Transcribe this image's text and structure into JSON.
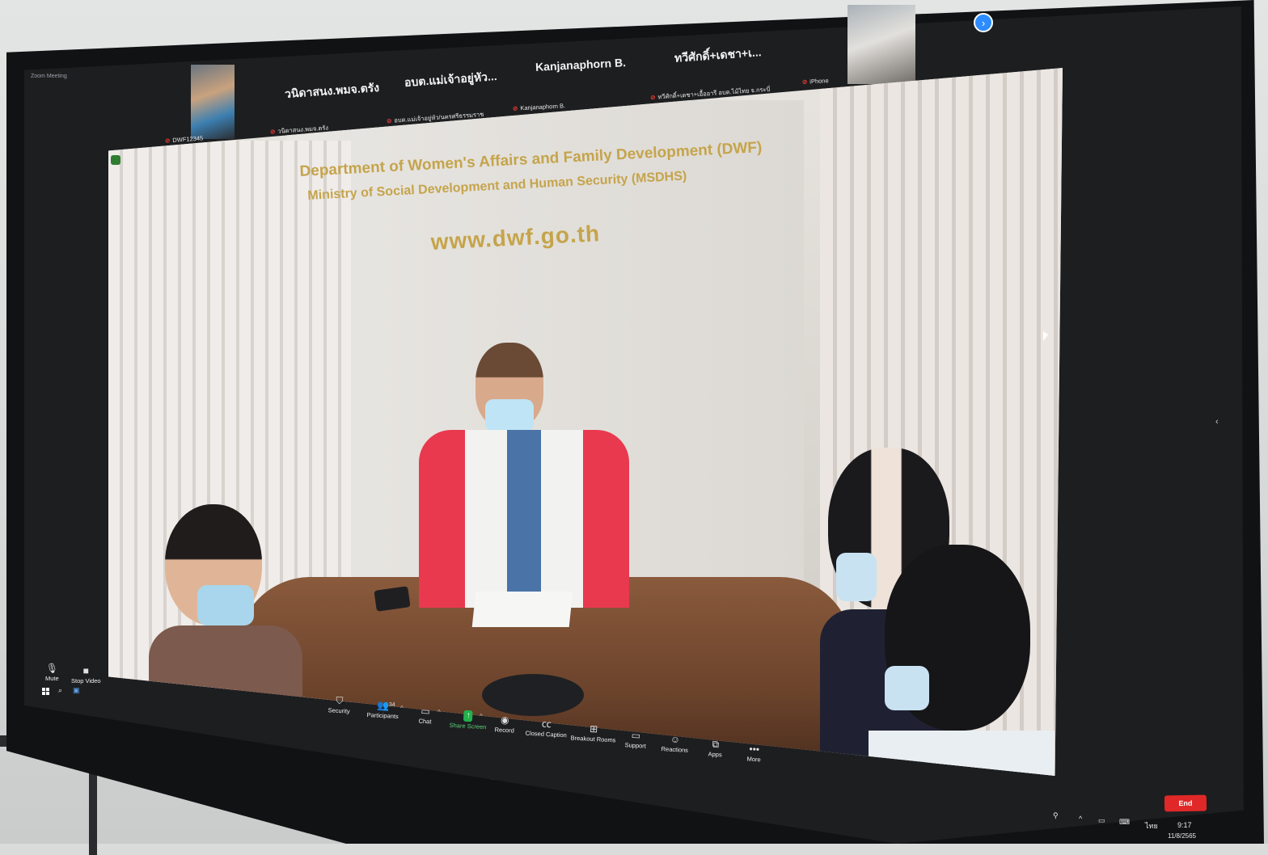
{
  "app": {
    "window_title": "Zoom Meeting"
  },
  "participants_strip": [
    {
      "name": "วนิดาสนง.พมจ.ตรัง",
      "sub": "วนิดาสนง.พมจ.ตรัง"
    },
    {
      "name": "อบต.แม่เจ้าอยู่หัว...",
      "sub": "อบต.แม่เจ้าอยู่หัว/นครศรีธรรมราช"
    },
    {
      "name": "Kanjanaphorn B.",
      "sub": "Kanjanaphorn B."
    },
    {
      "name": "ทวีศักดิ์+เดชา+เ...",
      "sub": "ทวีศักดิ์+เดชา+เอื้ออารี อบต.ไม้ไทย จ.กระบี่"
    },
    {
      "sub": "iPhone"
    }
  ],
  "camera_tile_label": "DWF12345",
  "main_video": {
    "sign": {
      "line1": "Department of Women's Affairs and Family Development (DWF)",
      "line2": "Ministry of Social Development and Human Security (MSDHS)",
      "url": "www.dwf.go.th"
    }
  },
  "toolbar": {
    "mute": "Mute",
    "stop_video": "Stop Video",
    "security": "Security",
    "participants": "Participants",
    "participants_count": "34",
    "chat": "Chat",
    "share_screen": "Share Screen",
    "record": "Record",
    "closed_caption": "Closed Caption",
    "breakout_rooms": "Breakout Rooms",
    "support": "Support",
    "reactions": "Reactions",
    "apps": "Apps",
    "more": "More",
    "end": "End"
  },
  "taskbar": {
    "language": "ไทย",
    "time": "9:17",
    "date": "11/8/2565"
  },
  "colors": {
    "share_green": "#23b14d",
    "end_red": "#e02828",
    "zoom_blue": "#2d8cff"
  },
  "icons": [
    "microphone-icon",
    "video-camera-icon",
    "shield-icon",
    "participants-icon",
    "chat-icon",
    "share-screen-icon",
    "record-icon",
    "cc-icon",
    "breakout-rooms-icon",
    "support-icon",
    "reactions-icon",
    "apps-icon",
    "more-icon",
    "windows-logo-icon",
    "search-icon"
  ]
}
